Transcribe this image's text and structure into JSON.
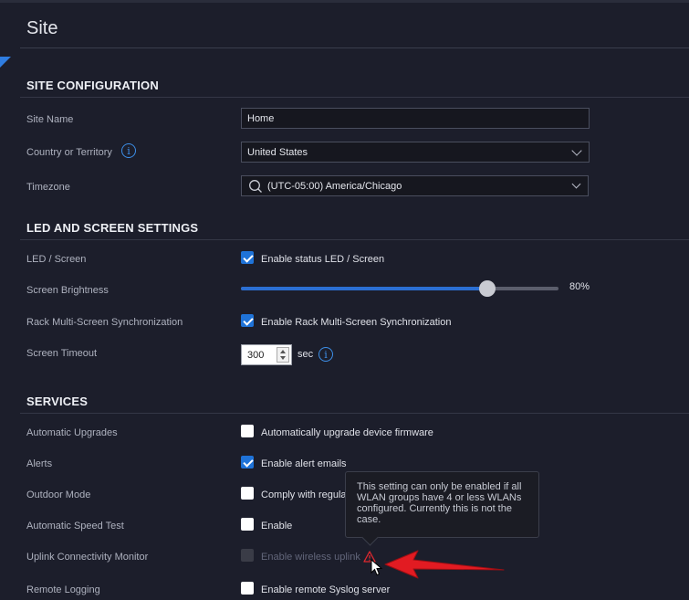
{
  "page": {
    "title": "Site"
  },
  "site_configuration": {
    "heading": "SITE CONFIGURATION",
    "site_name": {
      "label": "Site Name",
      "value": "Home"
    },
    "country": {
      "label": "Country or Territory",
      "value": "United States"
    },
    "timezone": {
      "label": "Timezone",
      "value": "(UTC-05:00) America/Chicago"
    }
  },
  "led_screen_settings": {
    "heading": "LED AND SCREEN SETTINGS",
    "led_screen": {
      "label": "LED / Screen",
      "option": "Enable status LED / Screen",
      "checked": true
    },
    "brightness": {
      "label": "Screen Brightness",
      "value_text": "80%",
      "value": 0.8
    },
    "rack_sync": {
      "label": "Rack Multi-Screen Synchronization",
      "option": "Enable Rack Multi-Screen Synchronization",
      "checked": true
    },
    "timeout": {
      "label": "Screen Timeout",
      "value": "300",
      "unit": "sec"
    }
  },
  "services": {
    "heading": "SERVICES",
    "auto_upgrades": {
      "label": "Automatic Upgrades",
      "option": "Automatically upgrade device firmware",
      "checked": false
    },
    "alerts": {
      "label": "Alerts",
      "option": "Enable alert emails",
      "checked": true
    },
    "outdoor_mode": {
      "label": "Outdoor Mode",
      "option": "Comply with regula",
      "checked": false
    },
    "speed_test": {
      "label": "Automatic Speed Test",
      "option": "Enable",
      "checked": false
    },
    "uplink_monitor": {
      "label": "Uplink Connectivity Monitor",
      "option": "Enable wireless uplink",
      "checked": false,
      "disabled": true
    },
    "remote_logging": {
      "label": "Remote Logging",
      "option": "Enable remote Syslog server",
      "checked": false
    }
  },
  "tooltip": {
    "text": "This setting can only be enabled if all WLAN groups have 4 or less WLANs configured. Currently this is not the case."
  },
  "icons": {
    "info": "info-icon",
    "warning": "warning-triangle-icon",
    "search": "search-icon",
    "dropdown": "chevron-down-icon",
    "cursor": "mouse-pointer-icon",
    "annotation": "red-arrow-annotation"
  },
  "colors": {
    "accent": "#1f73d8",
    "background": "#1c1e2b",
    "warning": "#e0292f"
  }
}
